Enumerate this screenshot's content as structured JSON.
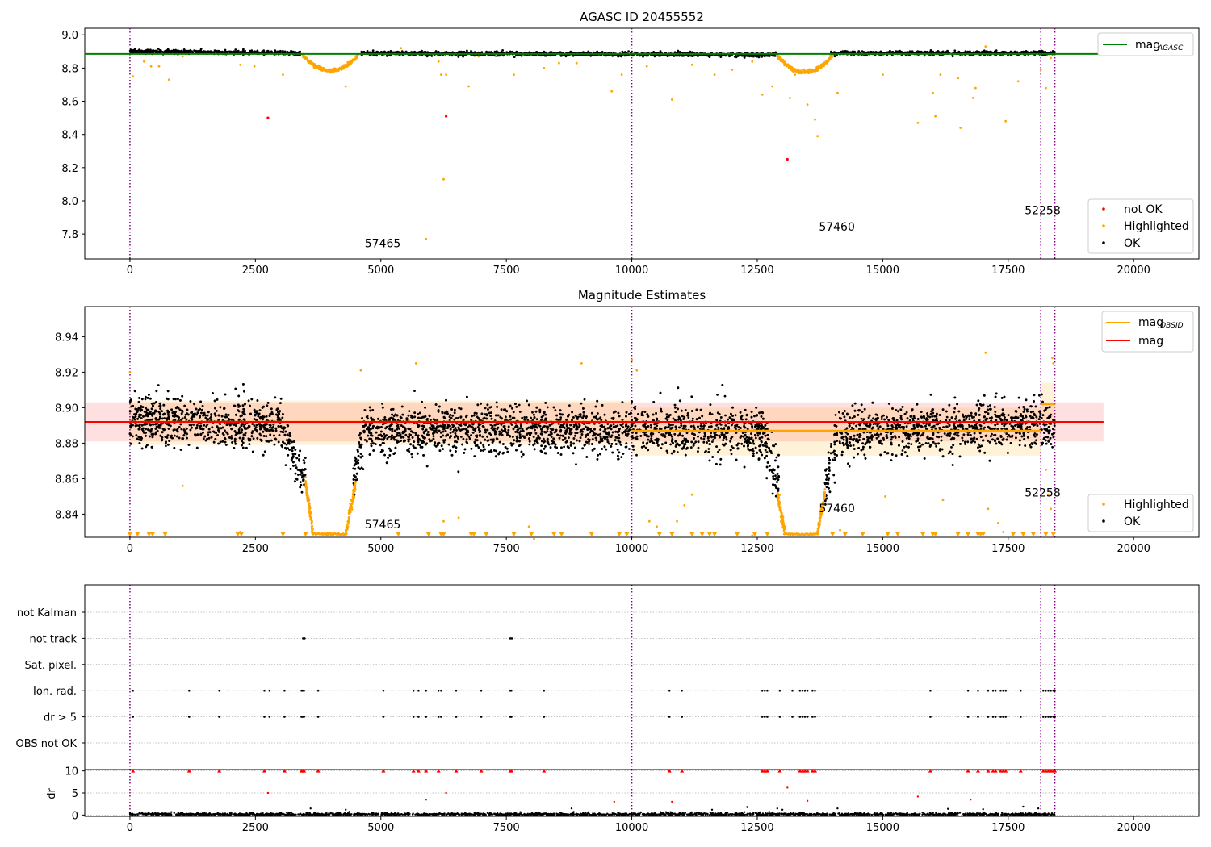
{
  "chart_data": [
    {
      "type": "scatter",
      "title": "AGASC ID 20455552",
      "xlabel": "",
      "ylabel": "",
      "xlim": [
        -900,
        21300
      ],
      "ylim": [
        7.65,
        9.04
      ],
      "xticks": [
        0,
        2500,
        5000,
        7500,
        10000,
        12500,
        15000,
        17500,
        20000
      ],
      "yticks": [
        7.8,
        8.0,
        8.2,
        8.4,
        8.6,
        8.8,
        9.0
      ],
      "ytick_labels": [
        "7.8",
        "8.0",
        "8.2",
        "8.4",
        "8.6",
        "8.8",
        "9.0"
      ],
      "grid": false,
      "legend_upper": {
        "placement": "top-right",
        "entries": [
          {
            "name": "mag",
            "sub": "AGASC",
            "color": "#008000",
            "kind": "line"
          }
        ]
      },
      "legend_lower": {
        "placement": "lower-right",
        "entries": [
          {
            "name": "not OK",
            "color": "#ff0000",
            "kind": "marker"
          },
          {
            "name": "Highlighted",
            "color": "#ffa500",
            "kind": "marker"
          },
          {
            "name": "OK",
            "color": "#000000",
            "kind": "marker"
          }
        ]
      },
      "hlines": [
        {
          "y": 8.885,
          "x0": -900,
          "x1": 19400,
          "color": "#008000"
        }
      ],
      "vlines": [
        0,
        10000,
        18150,
        18430
      ],
      "annotations": [
        {
          "text": "57465",
          "x": 5000,
          "y": 7.72
        },
        {
          "text": "57460",
          "x": 14050,
          "y": 7.82
        },
        {
          "text": "52258",
          "x": 18150,
          "y": 7.92
        }
      ],
      "ok_profile": [
        [
          0,
          8.9
        ],
        [
          3400,
          8.89
        ],
        [
          3450,
          null
        ],
        [
          4550,
          null
        ],
        [
          4600,
          8.89
        ],
        [
          12900,
          8.88
        ],
        [
          12950,
          null
        ],
        [
          13900,
          null
        ],
        [
          13950,
          8.89
        ],
        [
          18430,
          8.89
        ]
      ],
      "dip_centers": [
        [
          4000,
          8.785
        ],
        [
          13450,
          8.775
        ]
      ],
      "not_ok_points": [
        [
          2750,
          8.5
        ],
        [
          6300,
          8.51
        ],
        [
          13100,
          8.25
        ]
      ],
      "highlighted_outliers": [
        [
          60,
          8.75
        ],
        [
          280,
          8.84
        ],
        [
          420,
          8.81
        ],
        [
          580,
          8.81
        ],
        [
          780,
          8.73
        ],
        [
          1050,
          8.87
        ],
        [
          2200,
          8.82
        ],
        [
          2480,
          8.81
        ],
        [
          3050,
          8.76
        ],
        [
          4300,
          8.69
        ],
        [
          5400,
          8.92
        ],
        [
          5900,
          7.77
        ],
        [
          6150,
          8.84
        ],
        [
          6200,
          8.76
        ],
        [
          6250,
          8.13
        ],
        [
          6300,
          8.76
        ],
        [
          6750,
          8.69
        ],
        [
          6950,
          8.87
        ],
        [
          7300,
          8.88
        ],
        [
          7650,
          8.76
        ],
        [
          8250,
          8.8
        ],
        [
          8550,
          8.83
        ],
        [
          8900,
          8.83
        ],
        [
          9600,
          8.66
        ],
        [
          9800,
          8.76
        ],
        [
          10300,
          8.81
        ],
        [
          10800,
          8.61
        ],
        [
          11200,
          8.82
        ],
        [
          11650,
          8.76
        ],
        [
          12000,
          8.79
        ],
        [
          12400,
          8.84
        ],
        [
          12600,
          8.64
        ],
        [
          12800,
          8.69
        ],
        [
          13150,
          8.62
        ],
        [
          13250,
          8.76
        ],
        [
          13500,
          8.58
        ],
        [
          13650,
          8.49
        ],
        [
          13700,
          8.39
        ],
        [
          14100,
          8.65
        ],
        [
          15000,
          8.76
        ],
        [
          15700,
          8.47
        ],
        [
          16000,
          8.65
        ],
        [
          16050,
          8.51
        ],
        [
          16150,
          8.76
        ],
        [
          16500,
          8.74
        ],
        [
          16550,
          8.44
        ],
        [
          16800,
          8.62
        ],
        [
          16850,
          8.68
        ],
        [
          17050,
          8.93
        ],
        [
          17450,
          8.48
        ],
        [
          17700,
          8.72
        ],
        [
          18150,
          8.79
        ],
        [
          18250,
          8.68
        ],
        [
          18350,
          8.86
        ]
      ]
    },
    {
      "type": "scatter",
      "title": "Magnitude Estimates",
      "xlabel": "",
      "ylabel": "",
      "xlim": [
        -900,
        21300
      ],
      "ylim": [
        8.827,
        8.957
      ],
      "xticks": [
        0,
        2500,
        5000,
        7500,
        10000,
        12500,
        15000,
        17500,
        20000
      ],
      "yticks": [
        8.84,
        8.86,
        8.88,
        8.9,
        8.92,
        8.94
      ],
      "ytick_labels": [
        "8.84",
        "8.86",
        "8.88",
        "8.90",
        "8.92",
        "8.94"
      ],
      "grid": false,
      "legend_upper": {
        "placement": "top-right",
        "entries": [
          {
            "name": "mag",
            "sub": "OBSID",
            "color": "#ffa500",
            "kind": "line"
          },
          {
            "name": "mag",
            "sub": "",
            "color": "#ff0000",
            "kind": "line"
          }
        ]
      },
      "legend_lower": {
        "placement": "lower-right",
        "entries": [
          {
            "name": "Highlighted",
            "color": "#ffa500",
            "kind": "marker"
          },
          {
            "name": "OK",
            "color": "#000000",
            "kind": "marker"
          }
        ]
      },
      "mag_line": {
        "y": 8.892,
        "band": [
          8.881,
          8.903
        ],
        "x0": -900,
        "x1": 19400
      },
      "obsid_segments": [
        {
          "x0": 0,
          "x1": 10000,
          "y": 8.892,
          "band": [
            8.879,
            8.904
          ]
        },
        {
          "x0": 10000,
          "x1": 18150,
          "y": 8.887,
          "band": [
            8.873,
            8.9
          ]
        },
        {
          "x0": 18150,
          "x1": 18430,
          "y": 8.902,
          "band": [
            8.89,
            8.914
          ]
        }
      ],
      "vlines": [
        0,
        10000,
        18150,
        18430
      ],
      "annotations": [
        {
          "text": "57465",
          "x": 5000,
          "y": 8.832
        },
        {
          "text": "57460",
          "x": 14050,
          "y": 8.841
        },
        {
          "text": "52258",
          "x": 18150,
          "y": 8.85
        }
      ],
      "ok_profile": [
        [
          0,
          8.893
        ],
        [
          3000,
          8.89
        ],
        [
          3200,
          8.88
        ],
        [
          3350,
          8.868
        ],
        [
          3500,
          8.858
        ],
        [
          3520,
          null
        ],
        [
          4420,
          null
        ],
        [
          4450,
          8.86
        ],
        [
          4550,
          8.872
        ],
        [
          4700,
          8.887
        ],
        [
          12600,
          8.887
        ],
        [
          12750,
          8.873
        ],
        [
          12900,
          8.86
        ],
        [
          12950,
          8.852
        ],
        [
          13000,
          null
        ],
        [
          13800,
          null
        ],
        [
          13850,
          8.852
        ],
        [
          13950,
          8.868
        ],
        [
          14100,
          8.885
        ],
        [
          18430,
          8.892
        ]
      ],
      "highlighted_ramps": [
        [
          3500,
          8.858,
          3650,
          8.829
        ],
        [
          4300,
          8.829,
          4500,
          8.858
        ],
        [
          12900,
          8.852,
          13050,
          8.829
        ],
        [
          13700,
          8.829,
          13850,
          8.852
        ]
      ],
      "floor_segments": [
        [
          3650,
          4300
        ],
        [
          13050,
          13700
        ]
      ],
      "floor_value": 8.8288,
      "floor_markers_x": [
        0,
        150,
        380,
        450,
        700,
        2150,
        2220,
        3050,
        3500,
        5350,
        5950,
        6200,
        6250,
        6800,
        6850,
        7100,
        7650,
        8000,
        8450,
        8600,
        9200,
        9750,
        9900,
        10550,
        10800,
        11200,
        11400,
        11550,
        11650,
        12100,
        12450,
        12700,
        14000,
        14250,
        14600,
        15100,
        15300,
        15800,
        16000,
        16050,
        16500,
        16700,
        16900,
        16950,
        17000,
        17600,
        17800,
        18000,
        18250,
        18400
      ],
      "highlighted_outliers": [
        [
          0,
          8.92
        ],
        [
          1050,
          8.856
        ],
        [
          2200,
          8.83
        ],
        [
          4600,
          8.921
        ],
        [
          5700,
          8.925
        ],
        [
          6250,
          8.836
        ],
        [
          6550,
          8.838
        ],
        [
          7950,
          8.833
        ],
        [
          8050,
          8.826
        ],
        [
          9000,
          8.925
        ],
        [
          10000,
          8.927
        ],
        [
          10100,
          8.921
        ],
        [
          10350,
          8.836
        ],
        [
          10500,
          8.833
        ],
        [
          10900,
          8.836
        ],
        [
          11050,
          8.845
        ],
        [
          11200,
          8.851
        ],
        [
          12400,
          8.828
        ],
        [
          14150,
          8.831
        ],
        [
          15050,
          8.85
        ],
        [
          16200,
          8.848
        ],
        [
          17050,
          8.931
        ],
        [
          17100,
          8.843
        ],
        [
          17300,
          8.835
        ],
        [
          17400,
          8.83
        ],
        [
          18250,
          8.865
        ],
        [
          18300,
          8.851
        ],
        [
          18350,
          8.843
        ],
        [
          18380,
          8.928
        ],
        [
          18400,
          8.925
        ]
      ]
    },
    {
      "type": "scatter",
      "title": "",
      "xlabel": "",
      "ylabel": "",
      "xlim": [
        -900,
        21300
      ],
      "xticks": [
        0,
        2500,
        5000,
        7500,
        10000,
        12500,
        15000,
        17500,
        20000
      ],
      "categories": [
        "not Kalman",
        "not track",
        "Sat. pixel.",
        "Ion. rad.",
        "dr > 5",
        "OBS not OK"
      ],
      "grid": true,
      "vlines": [
        0,
        10000,
        18150,
        18430
      ],
      "flags": {
        "not track": [
          3450,
          3480,
          7580,
          7610
        ],
        "Ion. rad.": [
          60,
          1180,
          1780,
          2680,
          2780,
          3080,
          3420,
          3440,
          3470,
          3750,
          5050,
          5650,
          5750,
          5900,
          6150,
          6200,
          6500,
          7000,
          7580,
          7600,
          8250,
          10750,
          11000,
          12600,
          12650,
          12700,
          12950,
          13200,
          13350,
          13400,
          13450,
          13500,
          13600,
          13650,
          15950,
          16700,
          16900,
          17100,
          17200,
          17250,
          17350,
          17400,
          17450,
          17750,
          18200,
          18250,
          18300,
          18350,
          18400,
          18430
        ],
        "dr > 5": [
          60,
          1180,
          1780,
          2680,
          2780,
          3080,
          3420,
          3440,
          3470,
          3750,
          5050,
          5650,
          5750,
          5900,
          6150,
          6200,
          6500,
          7000,
          7580,
          7600,
          8250,
          10750,
          11000,
          12600,
          12650,
          12700,
          12950,
          13200,
          13350,
          13400,
          13450,
          13500,
          13600,
          13650,
          15950,
          16700,
          16900,
          17100,
          17200,
          17250,
          17350,
          17400,
          17450,
          17750,
          18200,
          18250,
          18300,
          18350,
          18400,
          18430
        ]
      }
    },
    {
      "type": "scatter",
      "title": "",
      "xlabel": "",
      "ylabel": "dr",
      "xlim": [
        -900,
        21300
      ],
      "ylim": [
        -0.3,
        10.3
      ],
      "xticks": [
        0,
        2500,
        5000,
        7500,
        10000,
        12500,
        15000,
        17500,
        20000
      ],
      "yticks": [
        0,
        5,
        10
      ],
      "grid": true,
      "vlines": [
        0,
        10000,
        18150,
        18430
      ],
      "capped_points_x": [
        60,
        1180,
        1780,
        2680,
        3080,
        3420,
        3440,
        3470,
        3750,
        5050,
        5650,
        5750,
        5900,
        6150,
        6500,
        7000,
        7580,
        7600,
        8250,
        10750,
        11000,
        12600,
        12650,
        12700,
        12950,
        13350,
        13400,
        13450,
        13500,
        13600,
        13650,
        15950,
        16700,
        16900,
        17100,
        17200,
        17250,
        17350,
        17400,
        17450,
        17750,
        18200,
        18250,
        18300,
        18350,
        18400,
        18430
      ],
      "red_outliers": [
        [
          2750,
          5
        ],
        [
          5900,
          3.5
        ],
        [
          6300,
          5
        ],
        [
          9650,
          3
        ],
        [
          10800,
          3
        ],
        [
          13100,
          6.2
        ],
        [
          13500,
          3.2
        ],
        [
          15700,
          4.2
        ],
        [
          16750,
          3.5
        ]
      ],
      "black_outliers": [
        [
          3600,
          1.5
        ],
        [
          4300,
          1.2
        ],
        [
          8800,
          1.5
        ],
        [
          11600,
          1.2
        ],
        [
          12300,
          1.8
        ],
        [
          12900,
          1.5
        ],
        [
          13000,
          1.2
        ],
        [
          14100,
          1.5
        ],
        [
          16300,
          1.4
        ],
        [
          17000,
          1.3
        ],
        [
          17800,
          1.9
        ],
        [
          18100,
          1.5
        ]
      ]
    }
  ]
}
